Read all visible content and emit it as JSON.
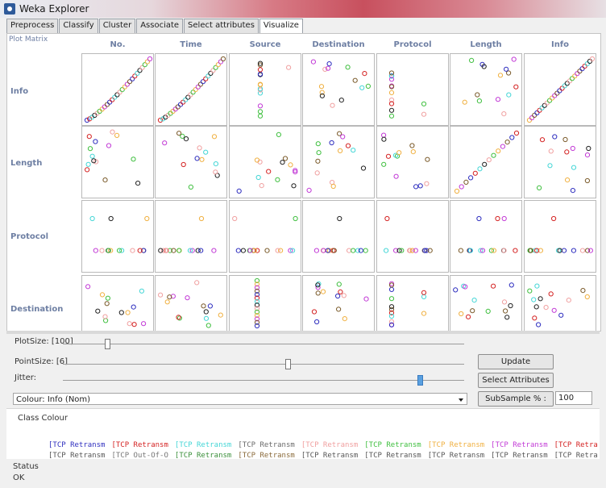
{
  "window": {
    "title": "Weka Explorer"
  },
  "tabs": [
    {
      "label": "Preprocess",
      "active": false
    },
    {
      "label": "Classify",
      "active": false
    },
    {
      "label": "Cluster",
      "active": false
    },
    {
      "label": "Associate",
      "active": false
    },
    {
      "label": "Select attributes",
      "active": false
    },
    {
      "label": "Visualize",
      "active": true
    }
  ],
  "plot_matrix": {
    "title": "Plot Matrix",
    "columns": [
      "No.",
      "Time",
      "Source",
      "Destination",
      "Protocol",
      "Length",
      "Info"
    ],
    "rows": [
      "Info",
      "Length",
      "Protocol",
      "Destination"
    ]
  },
  "controls": {
    "plot_size_label": "PlotSize: [100]",
    "plot_size_value": 0.11,
    "point_size_label": "PointSize: [6]",
    "point_size_value": 0.56,
    "jitter_label": "Jitter:",
    "jitter_value": 0.89,
    "update_label": "Update",
    "select_attributes_label": "Select Attributes",
    "subsample_label": "SubSample % :",
    "subsample_value": "100",
    "colour_select_value": "Colour: Info (Nom)"
  },
  "class_colour": {
    "title": "Class Colour",
    "row1": [
      {
        "text": "[TCP Retransm",
        "color": "#2e2ebf"
      },
      {
        "text": "[TCP Retransm",
        "color": "#d42222"
      },
      {
        "text": "[TCP Retransm",
        "color": "#44d6d6"
      },
      {
        "text": "[TCP Retransm",
        "color": "#6a6a6a"
      },
      {
        "text": "[TCP Retransm",
        "color": "#f0a0a0"
      },
      {
        "text": "[TCP Retransm",
        "color": "#3fbf3f"
      },
      {
        "text": "[TCP Retransm",
        "color": "#f0b040"
      },
      {
        "text": "[TCP Retransm",
        "color": "#c23ad6"
      },
      {
        "text": "[TCP Retra",
        "color": "#d42222"
      }
    ],
    "row2": [
      {
        "text": "[TCP Retransm",
        "color": "#555555"
      },
      {
        "text": "[TCP Out-Of-O",
        "color": "#777777"
      },
      {
        "text": "[TCP Retransm",
        "color": "#3a8f3a"
      },
      {
        "text": "[TCP Retransm",
        "color": "#8a6a3a"
      },
      {
        "text": "[TCP Retransm",
        "color": "#555555"
      },
      {
        "text": "[TCP Retransm",
        "color": "#555555"
      },
      {
        "text": "[TCP Retransm",
        "color": "#555555"
      },
      {
        "text": "[TCP Retransm",
        "color": "#555555"
      },
      {
        "text": "[TCP Retra",
        "color": "#555555"
      }
    ]
  },
  "status": {
    "label": "Status",
    "value": "OK"
  },
  "colors": {
    "point_palette": [
      "#2e2ebf",
      "#d42222",
      "#44d6d6",
      "#222222",
      "#f0a0a0",
      "#3fbf3f",
      "#f0b040",
      "#c23ad6",
      "#7a5a2a"
    ]
  }
}
